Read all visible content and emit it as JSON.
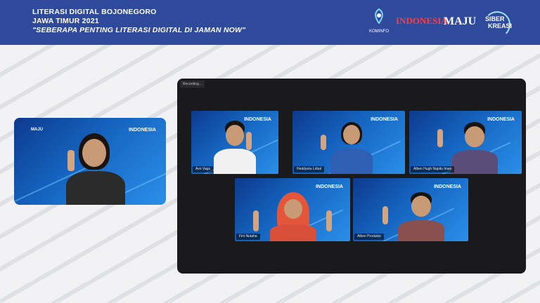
{
  "header": {
    "line1": "LITERASI DIGITAL BOJONEGORO",
    "line2": "JAWA TIMUR 2021",
    "line3": "\"SEBERAPA PENTING LITERASI DIGITAL DI JAMAN NOW\"",
    "logos": {
      "kominfo": "KOMINFO",
      "indonesia": "INDONESIA",
      "maju": "MAJU",
      "siber": "SIBER",
      "kreasi": "KREASI"
    }
  },
  "self_view": {
    "brand_left": "MAJU",
    "brand_right": "INDONESIA"
  },
  "meeting": {
    "recording_label": "Recording...",
    "participants": [
      {
        "name": "Avo Vags",
        "brand": "INDONESIA"
      },
      {
        "name": "Heddyeta Lirbal",
        "brand": "INDONESIA"
      },
      {
        "name": "Alben Hugh Napitu Iman",
        "brand": "INDONESIA"
      },
      {
        "name": "Fini Nutaha",
        "brand": "INDONESIA"
      },
      {
        "name": "Alben Produksi",
        "brand": "INDONESIA"
      }
    ]
  },
  "colors": {
    "header_bg": "#2f4a9b",
    "tile_blue": "#1565c0",
    "panel_bg": "#1a1a1c",
    "indonesia_red": "#ff3d3d"
  }
}
